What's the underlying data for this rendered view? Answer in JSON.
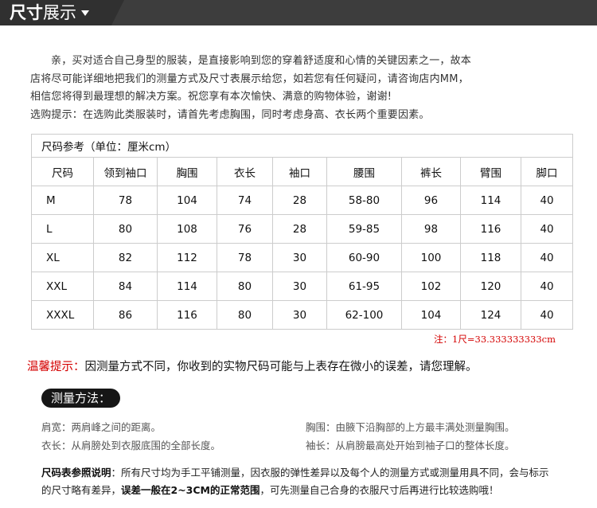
{
  "header": {
    "title_bold": "尺寸",
    "title_light": "展示"
  },
  "intro": {
    "line1": "亲，买对适合自己身型的服装，是直接影响到您的穿着舒适度和心情的关键因素之一，故本",
    "line2": "店将尽可能详细地把我们的测量方式及尺寸表展示给您，如若您有任何疑问，请咨询店内MM，",
    "line3": "相信您将得到最理想的解决方案。祝您享有本次愉快、满意的购物体验，谢谢!",
    "line4": "选购提示：在选购此类服装时，请首先考虑胸围，同时考虑身高、衣长两个重要因素。"
  },
  "table": {
    "title": "尺码参考（单位：厘米cm）",
    "headers": [
      "尺码",
      "领到袖口",
      "胸围",
      "衣长",
      "袖口",
      "腰围",
      "裤长",
      "臂围",
      "脚口"
    ],
    "rows": [
      [
        "M",
        "78",
        "104",
        "74",
        "28",
        "58-80",
        "96",
        "114",
        "40"
      ],
      [
        "L",
        "80",
        "108",
        "76",
        "28",
        "59-85",
        "98",
        "116",
        "40"
      ],
      [
        "XL",
        "82",
        "112",
        "78",
        "30",
        "60-90",
        "100",
        "118",
        "40"
      ],
      [
        "XXL",
        "84",
        "114",
        "80",
        "30",
        "61-95",
        "102",
        "120",
        "40"
      ],
      [
        "XXXL",
        "86",
        "116",
        "80",
        "30",
        "62-100",
        "104",
        "124",
        "40"
      ]
    ]
  },
  "note": "注：1尺=33.333333333cm",
  "tip": {
    "label": "温馨提示：",
    "text": "因测量方式不同，你收到的实物尺码可能与上表存在微小的误差，请您理解。"
  },
  "measure": {
    "title": "测量方法：",
    "shoulder": "肩宽：两肩峰之间的距离。",
    "chest": "胸围：由腋下沿胸部的上方最丰满处测量胸围。",
    "length": "衣长：从肩膀处到衣服底围的全部长度。",
    "sleeve": "袖长：从肩膀最高处开始到袖子口的整体长度。"
  },
  "footer": {
    "label": "尺码表参照说明",
    "line1": "：所有尺寸均为手工平铺测量，因衣服的弹性差异以及每个人的测量方式或测量用具不同，会与标示",
    "line2a": "的尺寸略有差异，",
    "line2b": "误差一般在2~3CM的正常范围",
    "line2c": "，可先测量自己合身的衣服尺寸后再进行比较选购哦！"
  }
}
